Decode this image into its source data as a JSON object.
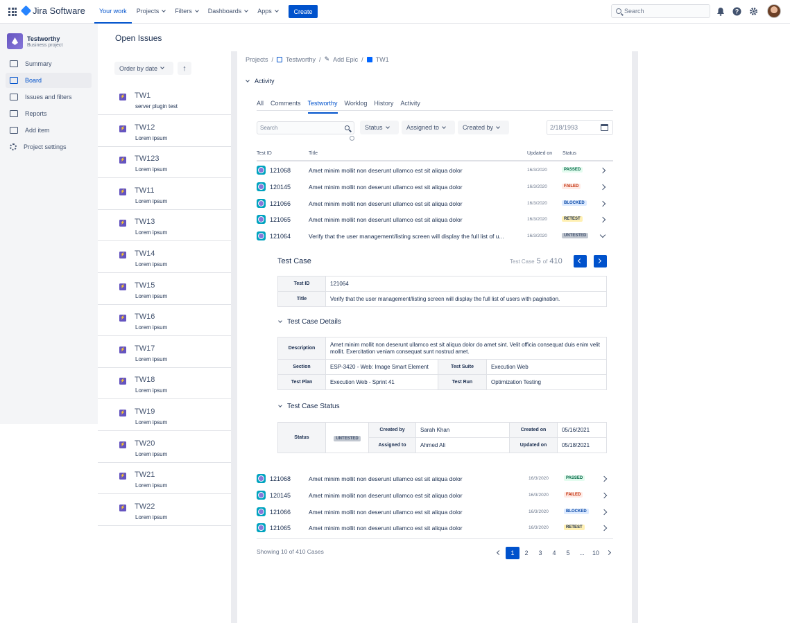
{
  "topbar": {
    "product": "Jira Software",
    "nav": [
      {
        "label": "Your work",
        "active": true
      },
      {
        "label": "Projects"
      },
      {
        "label": "Filters"
      },
      {
        "label": "Dashboards"
      },
      {
        "label": "Apps"
      }
    ],
    "create": "Create",
    "search_placeholder": "Search"
  },
  "project": {
    "name": "Testworthy",
    "type": "Business project"
  },
  "sidebar": {
    "items": [
      {
        "label": "Summary"
      },
      {
        "label": "Board",
        "active": true
      },
      {
        "label": "Issues and filters"
      },
      {
        "label": "Reports"
      },
      {
        "label": "Add item"
      },
      {
        "label": "Project settings"
      }
    ]
  },
  "issues_panel": {
    "title": "Open Issues",
    "order_by": "Order by date",
    "issues": [
      {
        "key": "TW1",
        "summary": "server plugin test"
      },
      {
        "key": "TW12",
        "summary": "Lorem ipsum"
      },
      {
        "key": "TW123",
        "summary": "Lorem ipsum"
      },
      {
        "key": "TW11",
        "summary": "Lorem ipsum"
      },
      {
        "key": "TW13",
        "summary": "Lorem ipsum"
      },
      {
        "key": "TW14",
        "summary": "Lorem ipsum"
      },
      {
        "key": "TW15",
        "summary": "Lorem ipsum"
      },
      {
        "key": "TW16",
        "summary": "Lorem ipsum"
      },
      {
        "key": "TW17",
        "summary": "Lorem ipsum"
      },
      {
        "key": "TW18",
        "summary": "Lorem ipsum"
      },
      {
        "key": "TW19",
        "summary": "Lorem ipsum"
      },
      {
        "key": "TW20",
        "summary": "Lorem ipsum"
      },
      {
        "key": "TW21",
        "summary": "Lorem ipsum"
      },
      {
        "key": "TW22",
        "summary": "Lorem ipsum"
      }
    ]
  },
  "breadcrumbs": [
    "Projects",
    "Testworthy",
    "Add Epic",
    "TW1"
  ],
  "activity_label": "Activity",
  "tabs": [
    {
      "label": "All"
    },
    {
      "label": "Comments"
    },
    {
      "label": "Testworthy",
      "active": true
    },
    {
      "label": "Worklog"
    },
    {
      "label": "History"
    },
    {
      "label": "Activity"
    }
  ],
  "filters": {
    "search_placeholder": "Search",
    "status": "Status",
    "assigned_to": "Assigned to",
    "created_by": "Created by",
    "date_value": "2/18/1993"
  },
  "table": {
    "headers": {
      "id": "Test ID",
      "title": "Title",
      "updated": "Updated on",
      "status": "Status"
    },
    "rows_top": [
      {
        "id": "121068",
        "title": "Amet minim mollit non deserunt ullamco est sit aliqua dolor",
        "updated": "16/3/2020",
        "status": "PASSED",
        "cls": "passed"
      },
      {
        "id": "120145",
        "title": "Amet minim mollit non deserunt ullamco est sit aliqua dolor",
        "updated": "16/3/2020",
        "status": "FAILED",
        "cls": "failed"
      },
      {
        "id": "121066",
        "title": "Amet minim mollit non deserunt ullamco est sit aliqua dolor",
        "updated": "16/3/2020",
        "status": "BLOCKED",
        "cls": "blocked"
      },
      {
        "id": "121065",
        "title": "Amet minim mollit non deserunt ullamco est sit aliqua dolor",
        "updated": "16/3/2020",
        "status": "RETEST",
        "cls": "retest"
      },
      {
        "id": "121064",
        "title": "Verify that the user management/listing screen will display the full list of u...",
        "updated": "16/3/2020",
        "status": "UNTESTED",
        "cls": "untested",
        "expanded": true
      }
    ],
    "rows_bottom": [
      {
        "id": "121068",
        "title": "Amet minim mollit non deserunt ullamco est sit aliqua dolor",
        "updated": "16/3/2020",
        "status": "PASSED",
        "cls": "passed"
      },
      {
        "id": "120145",
        "title": "Amet minim mollit non deserunt ullamco est sit aliqua dolor",
        "updated": "16/3/2020",
        "status": "FAILED",
        "cls": "failed"
      },
      {
        "id": "121066",
        "title": "Amet minim mollit non deserunt ullamco est sit aliqua dolor",
        "updated": "16/3/2020",
        "status": "BLOCKED",
        "cls": "blocked"
      },
      {
        "id": "121065",
        "title": "Amet minim mollit non deserunt ullamco est sit aliqua dolor",
        "updated": "16/3/2020",
        "status": "RETEST",
        "cls": "retest"
      }
    ]
  },
  "test_case": {
    "header": "Test Case",
    "counter_label": "Test Case",
    "current": "5",
    "of": "of",
    "total": "410",
    "id_label": "Test ID",
    "id_value": "121064",
    "title_label": "Title",
    "title_value": "Verify that the user management/listing screen will display the full list of users with pagination.",
    "details_header": "Test Case Details",
    "description_label": "Description",
    "description_value": "Amet minim mollit non deserunt ullamco est sit aliqua dolor do amet sint. Velit officia consequat duis enim velit mollit. Exercitation veniam consequat sunt nostrud amet.",
    "section_label": "Section",
    "section_value": "ESP-3420 - Web: Image Smart Element",
    "suite_label": "Test Suite",
    "suite_value": "Execution Web",
    "plan_label": "Test Plan",
    "plan_value": "Execution Web - Sprint 41",
    "run_label": "Test Run",
    "run_value": "Optimization Testing",
    "status_header": "Test Case Status",
    "status_label": "Status",
    "status_value": "UNTESTED",
    "created_by_label": "Created by",
    "created_by_value": "Sarah Khan",
    "assigned_label": "Assigned to",
    "assigned_value": "Ahmed Ali",
    "created_on_label": "Created on",
    "created_on_value": "05/16/2021",
    "updated_on_label": "Updated on",
    "updated_on_value": "05/18/2021"
  },
  "footer": {
    "showing": "Showing 10 of 410 Cases",
    "pages": [
      "1",
      "2",
      "3",
      "4",
      "5",
      "...",
      "10"
    ]
  }
}
